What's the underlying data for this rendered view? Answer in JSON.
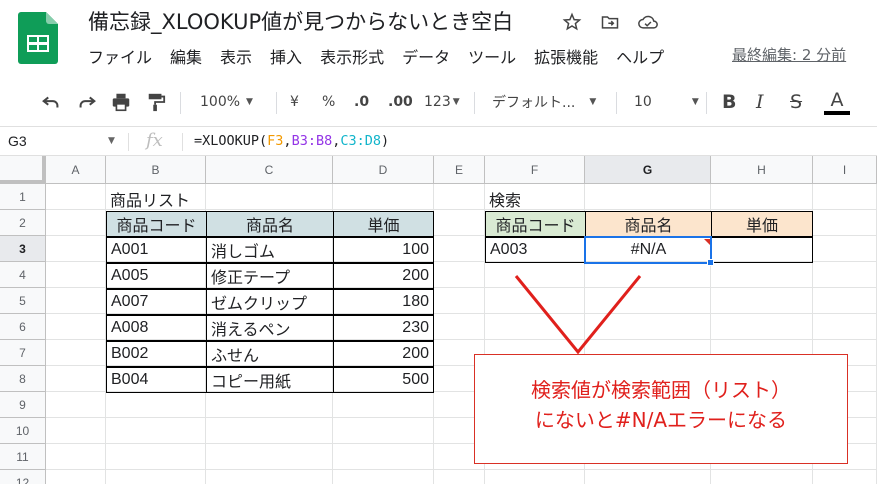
{
  "app": {
    "doc_title": "備忘録_XLOOKUP値が見つからないとき空白",
    "menu": [
      "ファイル",
      "編集",
      "表示",
      "挿入",
      "表示形式",
      "データ",
      "ツール",
      "拡張機能",
      "ヘルプ"
    ],
    "last_edit": "最終編集: 2 分前"
  },
  "toolbar": {
    "zoom": "100%",
    "currency": "¥",
    "percent": "%",
    "decimal_decrease": ".0",
    "decimal_increase": ".00",
    "number_format": "123",
    "font": "デフォルト...",
    "font_size": "10",
    "bold": "B",
    "italic": "I",
    "strike": "S",
    "text_color": "A"
  },
  "formula_bar": {
    "name_box": "G3",
    "fx": "fx",
    "formula_parts": [
      {
        "text": "=XLOOKUP(",
        "color": "#202124"
      },
      {
        "text": "F3",
        "color": "#f29900"
      },
      {
        "text": ",",
        "color": "#202124"
      },
      {
        "text": "B3:B8",
        "color": "#9334e6"
      },
      {
        "text": ",",
        "color": "#202124"
      },
      {
        "text": "C3:D8",
        "color": "#12b5cb"
      },
      {
        "text": ")",
        "color": "#202124"
      }
    ]
  },
  "grid": {
    "columns": [
      "A",
      "B",
      "C",
      "D",
      "E",
      "F",
      "G",
      "H",
      "I"
    ],
    "rows": [
      "1",
      "2",
      "3",
      "4",
      "5",
      "6",
      "7",
      "8",
      "9",
      "10",
      "11",
      "12"
    ],
    "selected_column": "G",
    "selected_row": "3"
  },
  "product_list": {
    "title": "商品リスト",
    "headers": [
      "商品コード",
      "商品名",
      "単価"
    ],
    "rows": [
      [
        "A001",
        "消しゴム",
        "100"
      ],
      [
        "A005",
        "修正テープ",
        "200"
      ],
      [
        "A007",
        "ゼムクリップ",
        "180"
      ],
      [
        "A008",
        "消えるペン",
        "230"
      ],
      [
        "B002",
        "ふせん",
        "200"
      ],
      [
        "B004",
        "コピー用紙",
        "500"
      ]
    ]
  },
  "search": {
    "title": "検索",
    "headers": [
      "商品コード",
      "商品名",
      "単価"
    ],
    "code": "A003",
    "name_result": "#N/A",
    "price_result": ""
  },
  "callout": {
    "line1": "検索値が検索範囲（リスト）",
    "line2": "にないと#N/Aエラーになる"
  },
  "colors": {
    "header_green": "#d9ead3",
    "header_blue": "#d0e0e3",
    "header_orange": "#fce5cd",
    "accent_blue": "#1a73e8",
    "annotation_red": "#e0201c"
  }
}
